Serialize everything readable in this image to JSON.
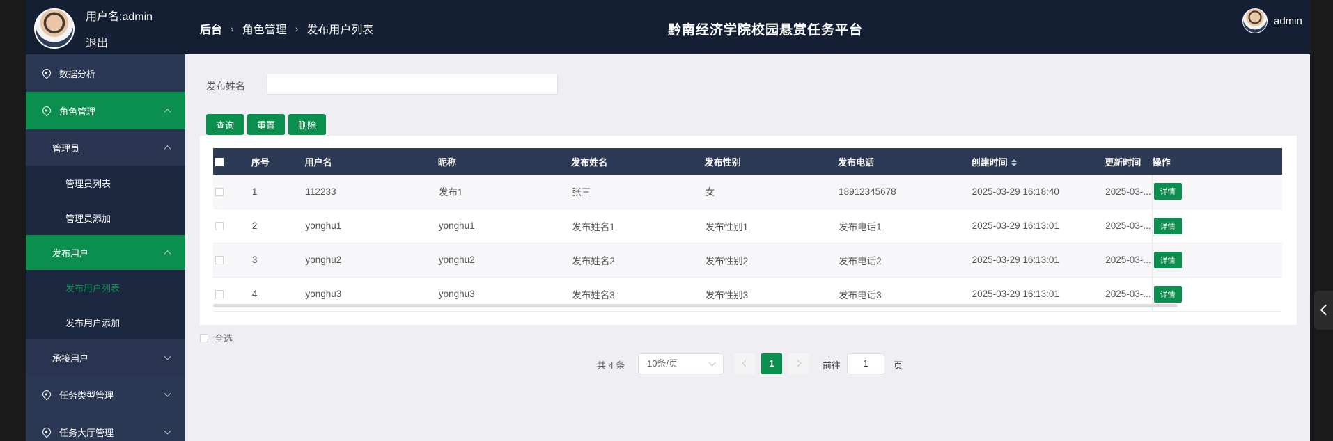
{
  "header": {
    "username_label": "用户名:admin",
    "logout": "退出",
    "breadcrumb": [
      "后台",
      "角色管理",
      "发布用户列表"
    ],
    "site_title": "黔南经济学院校园悬赏任务平台",
    "user_name": "admin"
  },
  "sidebar": {
    "items": [
      {
        "label": "数据分析"
      },
      {
        "label": "角色管理"
      },
      {
        "label": "管理员"
      },
      {
        "label": "管理员列表"
      },
      {
        "label": "管理员添加"
      },
      {
        "label": "发布用户"
      },
      {
        "label": "发布用户列表"
      },
      {
        "label": "发布用户添加"
      },
      {
        "label": "承接用户"
      },
      {
        "label": "任务类型管理"
      },
      {
        "label": "任务大厅管理"
      }
    ]
  },
  "search": {
    "label": "发布姓名",
    "value": "",
    "query_btn": "查询",
    "reset_btn": "重置",
    "delete_btn": "删除"
  },
  "table": {
    "headers": [
      "序号",
      "用户名",
      "昵称",
      "发布姓名",
      "发布性别",
      "发布电话",
      "创建时间",
      "更新时间",
      "操作"
    ],
    "rows": [
      {
        "no": "1",
        "username": "112233",
        "nickname": "发布1",
        "name": "张三",
        "gender": "女",
        "phone": "18912345678",
        "created": "2025-03-29 16:18:40",
        "updated": "2025-03-...",
        "action": "详情"
      },
      {
        "no": "2",
        "username": "yonghu1",
        "nickname": "yonghu1",
        "name": "发布姓名1",
        "gender": "发布性别1",
        "phone": "发布电话1",
        "created": "2025-03-29 16:13:01",
        "updated": "2025-03-...",
        "action": "详情"
      },
      {
        "no": "3",
        "username": "yonghu2",
        "nickname": "yonghu2",
        "name": "发布姓名2",
        "gender": "发布性别2",
        "phone": "发布电话2",
        "created": "2025-03-29 16:13:01",
        "updated": "2025-03-...",
        "action": "详情"
      },
      {
        "no": "4",
        "username": "yonghu3",
        "nickname": "yonghu3",
        "name": "发布姓名3",
        "gender": "发布性别3",
        "phone": "发布电话3",
        "created": "2025-03-29 16:13:01",
        "updated": "2025-03-...",
        "action": "详情"
      }
    ]
  },
  "select_all": "全选",
  "pagination": {
    "total": "共 4 条",
    "page_size": "10条/页",
    "current": "1",
    "goto_label": "前往",
    "goto_value": "1",
    "page_suffix": "页"
  },
  "colors": {
    "header_bg": "#151f33",
    "sidebar_bg": "#293550",
    "accent": "#0a8f4e"
  }
}
